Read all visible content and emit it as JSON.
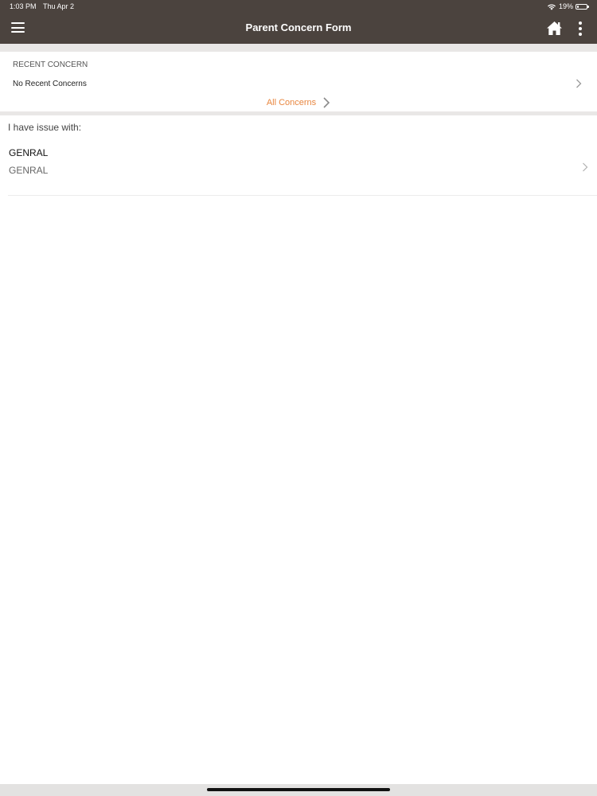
{
  "status_bar": {
    "time": "1:03 PM",
    "date": "Thu Apr 2",
    "battery_percent": "19%",
    "battery_level": 0.19,
    "icons": [
      "wifi-icon",
      "battery-icon"
    ]
  },
  "nav": {
    "title": "Parent Concern Form",
    "icons": [
      "menu-icon",
      "home-icon",
      "more-vertical-icon"
    ],
    "bar_color": "#4b433e"
  },
  "recent": {
    "heading": "RECENT CONCERN",
    "empty_label": "No Recent Concerns",
    "all_link": "All Concerns",
    "accent_color": "#e8863f"
  },
  "issues": {
    "prompt": "I have issue with:",
    "items": [
      {
        "title": "GENRAL",
        "subtitle": "GENRAL"
      }
    ]
  }
}
